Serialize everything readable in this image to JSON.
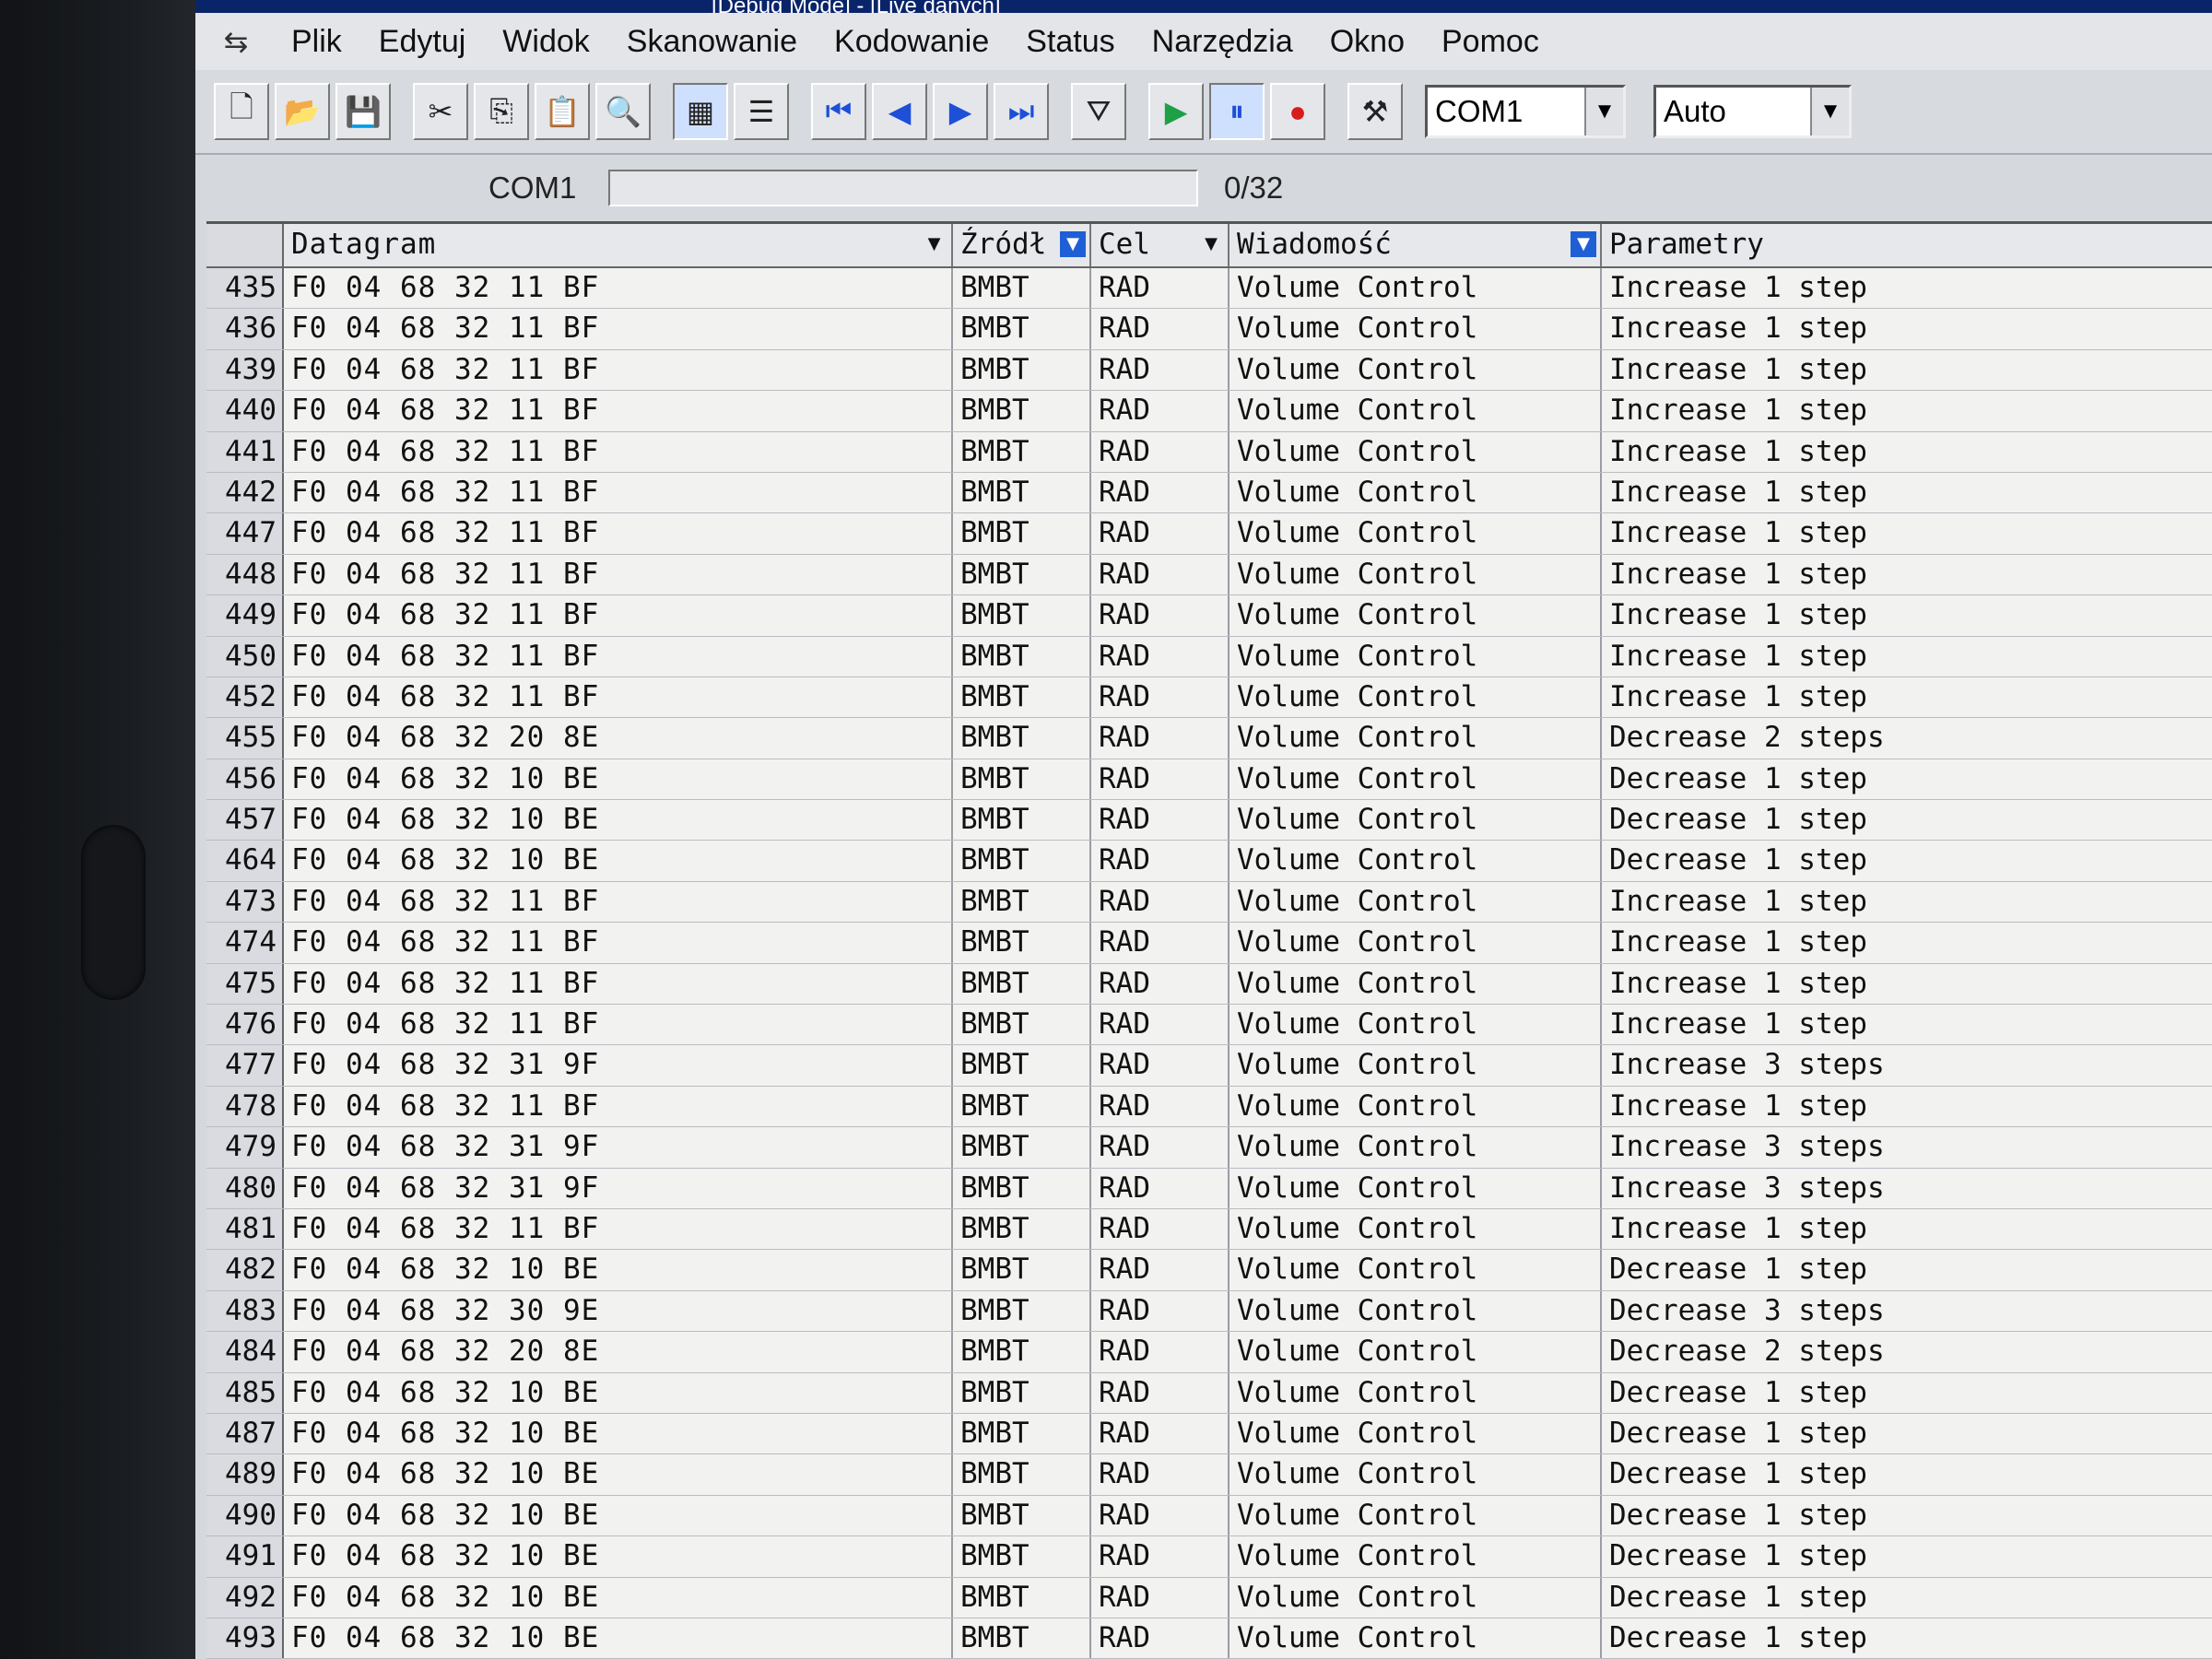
{
  "window": {
    "title_fragment": "[Debug Mode] - [Live danych]"
  },
  "menu": [
    "Plik",
    "Edytuj",
    "Widok",
    "Skanowanie",
    "Kodowanie",
    "Status",
    "Narzędzia",
    "Okno",
    "Pomoc"
  ],
  "toolbar": {
    "port_value": "COM1",
    "mode_value": "Auto"
  },
  "portbar": {
    "label": "COM1",
    "progress": 0,
    "counter": "0/32"
  },
  "grid": {
    "columns": [
      "Datagram",
      "Źródł",
      "Cel",
      "Wiadomość",
      "Parametry"
    ],
    "rows": [
      [
        "435",
        "F0 04 68 32 11 BF",
        "BMBT",
        "RAD",
        "Volume Control",
        "Increase 1 step"
      ],
      [
        "436",
        "F0 04 68 32 11 BF",
        "BMBT",
        "RAD",
        "Volume Control",
        "Increase 1 step"
      ],
      [
        "439",
        "F0 04 68 32 11 BF",
        "BMBT",
        "RAD",
        "Volume Control",
        "Increase 1 step"
      ],
      [
        "440",
        "F0 04 68 32 11 BF",
        "BMBT",
        "RAD",
        "Volume Control",
        "Increase 1 step"
      ],
      [
        "441",
        "F0 04 68 32 11 BF",
        "BMBT",
        "RAD",
        "Volume Control",
        "Increase 1 step"
      ],
      [
        "442",
        "F0 04 68 32 11 BF",
        "BMBT",
        "RAD",
        "Volume Control",
        "Increase 1 step"
      ],
      [
        "447",
        "F0 04 68 32 11 BF",
        "BMBT",
        "RAD",
        "Volume Control",
        "Increase 1 step"
      ],
      [
        "448",
        "F0 04 68 32 11 BF",
        "BMBT",
        "RAD",
        "Volume Control",
        "Increase 1 step"
      ],
      [
        "449",
        "F0 04 68 32 11 BF",
        "BMBT",
        "RAD",
        "Volume Control",
        "Increase 1 step"
      ],
      [
        "450",
        "F0 04 68 32 11 BF",
        "BMBT",
        "RAD",
        "Volume Control",
        "Increase 1 step"
      ],
      [
        "452",
        "F0 04 68 32 11 BF",
        "BMBT",
        "RAD",
        "Volume Control",
        "Increase 1 step"
      ],
      [
        "455",
        "F0 04 68 32 20 8E",
        "BMBT",
        "RAD",
        "Volume Control",
        "Decrease 2 steps"
      ],
      [
        "456",
        "F0 04 68 32 10 BE",
        "BMBT",
        "RAD",
        "Volume Control",
        "Decrease 1 step"
      ],
      [
        "457",
        "F0 04 68 32 10 BE",
        "BMBT",
        "RAD",
        "Volume Control",
        "Decrease 1 step"
      ],
      [
        "464",
        "F0 04 68 32 10 BE",
        "BMBT",
        "RAD",
        "Volume Control",
        "Decrease 1 step"
      ],
      [
        "473",
        "F0 04 68 32 11 BF",
        "BMBT",
        "RAD",
        "Volume Control",
        "Increase 1 step"
      ],
      [
        "474",
        "F0 04 68 32 11 BF",
        "BMBT",
        "RAD",
        "Volume Control",
        "Increase 1 step"
      ],
      [
        "475",
        "F0 04 68 32 11 BF",
        "BMBT",
        "RAD",
        "Volume Control",
        "Increase 1 step"
      ],
      [
        "476",
        "F0 04 68 32 11 BF",
        "BMBT",
        "RAD",
        "Volume Control",
        "Increase 1 step"
      ],
      [
        "477",
        "F0 04 68 32 31 9F",
        "BMBT",
        "RAD",
        "Volume Control",
        "Increase 3 steps"
      ],
      [
        "478",
        "F0 04 68 32 11 BF",
        "BMBT",
        "RAD",
        "Volume Control",
        "Increase 1 step"
      ],
      [
        "479",
        "F0 04 68 32 31 9F",
        "BMBT",
        "RAD",
        "Volume Control",
        "Increase 3 steps"
      ],
      [
        "480",
        "F0 04 68 32 31 9F",
        "BMBT",
        "RAD",
        "Volume Control",
        "Increase 3 steps"
      ],
      [
        "481",
        "F0 04 68 32 11 BF",
        "BMBT",
        "RAD",
        "Volume Control",
        "Increase 1 step"
      ],
      [
        "482",
        "F0 04 68 32 10 BE",
        "BMBT",
        "RAD",
        "Volume Control",
        "Decrease 1 step"
      ],
      [
        "483",
        "F0 04 68 32 30 9E",
        "BMBT",
        "RAD",
        "Volume Control",
        "Decrease 3 steps"
      ],
      [
        "484",
        "F0 04 68 32 20 8E",
        "BMBT",
        "RAD",
        "Volume Control",
        "Decrease 2 steps"
      ],
      [
        "485",
        "F0 04 68 32 10 BE",
        "BMBT",
        "RAD",
        "Volume Control",
        "Decrease 1 step"
      ],
      [
        "487",
        "F0 04 68 32 10 BE",
        "BMBT",
        "RAD",
        "Volume Control",
        "Decrease 1 step"
      ],
      [
        "489",
        "F0 04 68 32 10 BE",
        "BMBT",
        "RAD",
        "Volume Control",
        "Decrease 1 step"
      ],
      [
        "490",
        "F0 04 68 32 10 BE",
        "BMBT",
        "RAD",
        "Volume Control",
        "Decrease 1 step"
      ],
      [
        "491",
        "F0 04 68 32 10 BE",
        "BMBT",
        "RAD",
        "Volume Control",
        "Decrease 1 step"
      ],
      [
        "492",
        "F0 04 68 32 10 BE",
        "BMBT",
        "RAD",
        "Volume Control",
        "Decrease 1 step"
      ],
      [
        "493",
        "F0 04 68 32 10 BE",
        "BMBT",
        "RAD",
        "Volume Control",
        "Decrease 1 step"
      ]
    ]
  }
}
